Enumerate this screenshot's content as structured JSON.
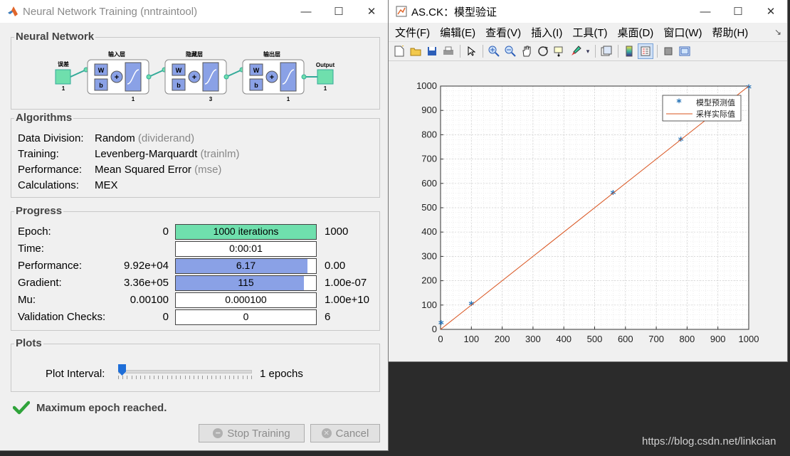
{
  "nn_window": {
    "title": "Neural Network Training (nntraintool)",
    "controls": {
      "minimize": "—",
      "maximize": "☐",
      "close": "✕"
    },
    "network": {
      "group_title": "Neural Network",
      "input_label": "误差",
      "input_size": "1",
      "layers": [
        {
          "title": "输入层",
          "size": "1",
          "w": "W",
          "b": "b"
        },
        {
          "title": "隐藏层",
          "size": "3",
          "w": "W",
          "b": "b"
        },
        {
          "title": "输出层",
          "size": "1",
          "w": "W",
          "b": "b"
        }
      ],
      "output_label": "Output",
      "output_size": "1"
    },
    "algorithms": {
      "group_title": "Algorithms",
      "rows": [
        {
          "label": "Data Division:",
          "value": "Random",
          "fn": "(dividerand)"
        },
        {
          "label": "Training:",
          "value": "Levenberg-Marquardt",
          "fn": "(trainlm)"
        },
        {
          "label": "Performance:",
          "value": "Mean Squared Error",
          "fn": "(mse)"
        },
        {
          "label": "Calculations:",
          "value": "MEX",
          "fn": ""
        }
      ]
    },
    "progress": {
      "group_title": "Progress",
      "rows": [
        {
          "label": "Epoch:",
          "min": "0",
          "bar": "1000 iterations",
          "max": "1000",
          "fill": 1.0,
          "color": "#6fdfad"
        },
        {
          "label": "Time:",
          "min": "",
          "bar": "0:00:01",
          "max": "",
          "fill": 0,
          "color": "#ffffff"
        },
        {
          "label": "Performance:",
          "min": "9.92e+04",
          "bar": "6.17",
          "max": "0.00",
          "fill": 0.94,
          "color": "#8aa1e6"
        },
        {
          "label": "Gradient:",
          "min": "3.36e+05",
          "bar": "115",
          "max": "1.00e-07",
          "fill": 0.915,
          "color": "#8aa1e6"
        },
        {
          "label": "Mu:",
          "min": "0.00100",
          "bar": "0.000100",
          "max": "1.00e+10",
          "fill": 0,
          "color": "#ffffff"
        },
        {
          "label": "Validation Checks:",
          "min": "0",
          "bar": "0",
          "max": "6",
          "fill": 0,
          "color": "#ffffff"
        }
      ]
    },
    "plots": {
      "group_title": "Plots",
      "interval_label": "Plot Interval:",
      "interval_value": "1 epochs",
      "slider_fraction": 0.0
    },
    "status_text": "Maximum epoch reached.",
    "stop_button": "Stop Training",
    "cancel_button": "Cancel"
  },
  "figure_window": {
    "title": "AS.CK：模型验证",
    "controls": {
      "minimize": "—",
      "maximize": "☐",
      "close": "✕"
    },
    "menu": [
      "文件(F)",
      "编辑(E)",
      "查看(V)",
      "插入(I)",
      "工具(T)",
      "桌面(D)",
      "窗口(W)",
      "帮助(H)"
    ],
    "menu_end_icon": "↘",
    "toolbar": [
      "new-file",
      "open-folder",
      "save",
      "print",
      "pointer",
      "zoom-in",
      "zoom-out",
      "pan",
      "rotate",
      "data-cursor",
      "brush",
      "link",
      "colorbar",
      "legend",
      "hide-plot-tools",
      "show-plot-tools"
    ]
  },
  "chart_data": {
    "type": "scatter",
    "title": "",
    "xlabel": "",
    "ylabel": "",
    "xlim": [
      0,
      1000
    ],
    "ylim": [
      0,
      1000
    ],
    "xticks": [
      0,
      100,
      200,
      300,
      400,
      500,
      600,
      700,
      800,
      900,
      1000
    ],
    "yticks": [
      0,
      100,
      200,
      300,
      400,
      500,
      600,
      700,
      800,
      900,
      1000
    ],
    "grid": true,
    "minor_grid": true,
    "legend_position": "top-right",
    "series": [
      {
        "name": "模型预测值",
        "kind": "scatter",
        "marker": "*",
        "color": "#1f6fb5",
        "x": [
          2,
          100,
          560,
          780,
          1000
        ],
        "y": [
          20,
          100,
          555,
          775,
          990
        ]
      },
      {
        "name": "采样实际值",
        "kind": "line",
        "color": "#d9531e",
        "x": [
          0,
          1000
        ],
        "y": [
          0,
          1000
        ]
      }
    ]
  },
  "watermark": "https://blog.csdn.net/linkcian"
}
